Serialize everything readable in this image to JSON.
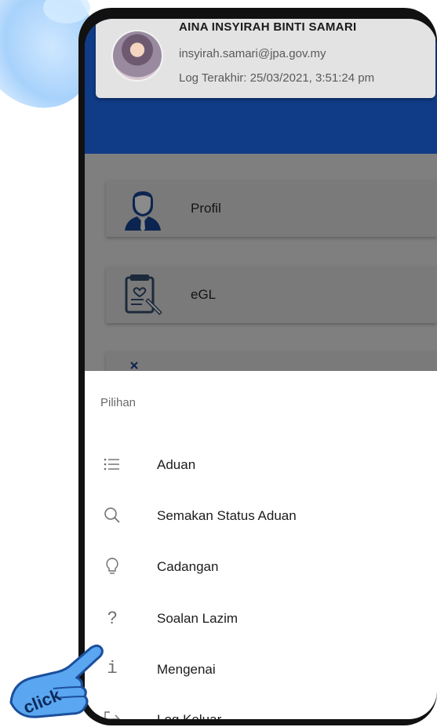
{
  "profile": {
    "name": "AINA INSYIRAH BINTI SAMARI",
    "email": "insyirah.samari@jpa.gov.my",
    "last_login": "Log Terakhir: 25/03/2021, 3:51:24 pm"
  },
  "menu": {
    "items": [
      {
        "label": "Profil",
        "icon": "person-icon"
      },
      {
        "label": "eGL",
        "icon": "document-icon"
      },
      {
        "label": "",
        "icon": "globe-icon"
      }
    ]
  },
  "sheet": {
    "title": "Pilihan",
    "options": [
      {
        "label": "Aduan",
        "icon": "list-icon"
      },
      {
        "label": "Semakan Status Aduan",
        "icon": "search-icon"
      },
      {
        "label": "Cadangan",
        "icon": "lightbulb-icon"
      },
      {
        "label": "Soalan Lazim",
        "icon": "question-icon"
      },
      {
        "label": "Mengenai",
        "icon": "info-icon"
      },
      {
        "label": "Log Keluar",
        "icon": "logout-icon"
      }
    ]
  },
  "overlay": {
    "hand_text": "click"
  },
  "colors": {
    "header_blue": "#103b86",
    "dim_overlay": "#7f7f7f"
  }
}
